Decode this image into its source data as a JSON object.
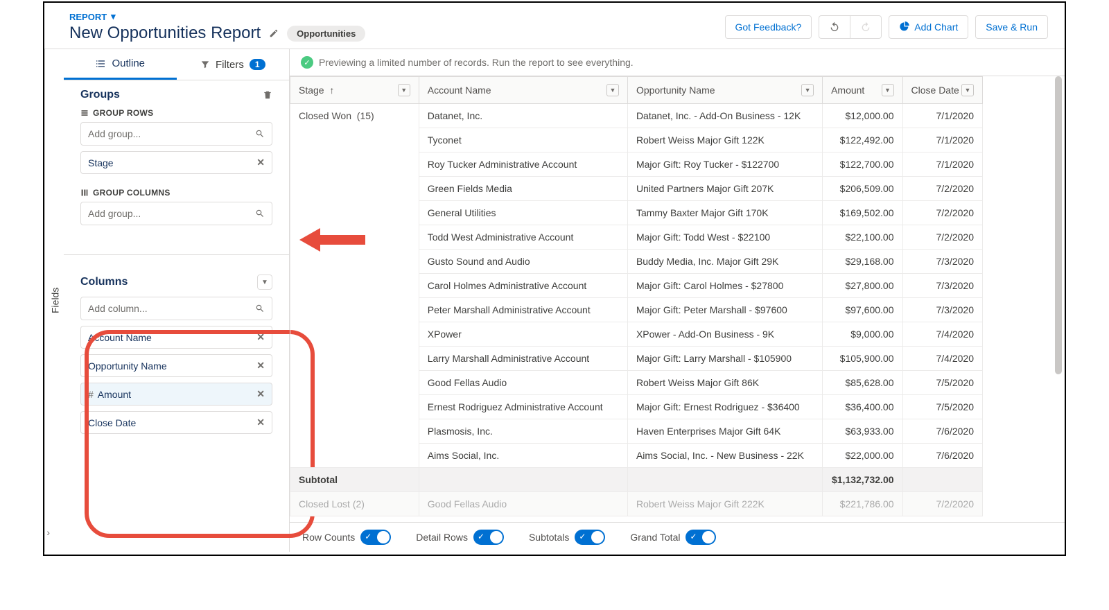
{
  "header": {
    "type_label": "REPORT",
    "title": "New Opportunities Report",
    "badge": "Opportunities",
    "feedback": "Got Feedback?",
    "add_chart": "Add Chart",
    "save_run": "Save & Run"
  },
  "fields_tab": "Fields",
  "sidebar": {
    "tabs": {
      "outline": "Outline",
      "filters": "Filters",
      "filter_count": "1"
    },
    "groups": {
      "title": "Groups",
      "rows_label": "GROUP ROWS",
      "rows_placeholder": "Add group...",
      "row_pill": "Stage",
      "cols_label": "GROUP COLUMNS",
      "cols_placeholder": "Add group..."
    },
    "columns": {
      "title": "Columns",
      "placeholder": "Add column...",
      "items": [
        "Account Name",
        "Opportunity Name",
        "# Amount",
        "Close Date"
      ]
    }
  },
  "preview_msg": "Previewing a limited number of records. Run the report to see everything.",
  "table": {
    "headers": [
      "Stage",
      "Account Name",
      "Opportunity Name",
      "Amount",
      "Close Date"
    ],
    "stage_group": "Closed Won",
    "stage_count": "(15)",
    "rows": [
      {
        "acct": "Datanet, Inc.",
        "opp": "Datanet, Inc. - Add-On Business - 12K",
        "amt": "$12,000.00",
        "date": "7/1/2020"
      },
      {
        "acct": "Tyconet",
        "opp": "Robert Weiss Major Gift 122K",
        "amt": "$122,492.00",
        "date": "7/1/2020"
      },
      {
        "acct": "Roy Tucker Administrative Account",
        "opp": "Major Gift: Roy Tucker - $122700",
        "amt": "$122,700.00",
        "date": "7/1/2020"
      },
      {
        "acct": "Green Fields Media",
        "opp": "United Partners Major Gift 207K",
        "amt": "$206,509.00",
        "date": "7/2/2020"
      },
      {
        "acct": "General Utilities",
        "opp": "Tammy Baxter Major Gift 170K",
        "amt": "$169,502.00",
        "date": "7/2/2020"
      },
      {
        "acct": "Todd West Administrative Account",
        "opp": "Major Gift: Todd West - $22100",
        "amt": "$22,100.00",
        "date": "7/2/2020"
      },
      {
        "acct": "Gusto Sound and Audio",
        "opp": "Buddy Media, Inc. Major Gift 29K",
        "amt": "$29,168.00",
        "date": "7/3/2020"
      },
      {
        "acct": "Carol Holmes Administrative Account",
        "opp": "Major Gift: Carol Holmes - $27800",
        "amt": "$27,800.00",
        "date": "7/3/2020"
      },
      {
        "acct": "Peter Marshall Administrative Account",
        "opp": "Major Gift: Peter Marshall - $97600",
        "amt": "$97,600.00",
        "date": "7/3/2020"
      },
      {
        "acct": "XPower",
        "opp": "XPower - Add-On Business - 9K",
        "amt": "$9,000.00",
        "date": "7/4/2020"
      },
      {
        "acct": "Larry Marshall Administrative Account",
        "opp": "Major Gift: Larry Marshall - $105900",
        "amt": "$105,900.00",
        "date": "7/4/2020"
      },
      {
        "acct": "Good Fellas Audio",
        "opp": "Robert Weiss Major Gift 86K",
        "amt": "$85,628.00",
        "date": "7/5/2020"
      },
      {
        "acct": "Ernest Rodriguez Administrative Account",
        "opp": "Major Gift: Ernest Rodriguez - $36400",
        "amt": "$36,400.00",
        "date": "7/5/2020"
      },
      {
        "acct": "Plasmosis, Inc.",
        "opp": "Haven Enterprises Major Gift 64K",
        "amt": "$63,933.00",
        "date": "7/6/2020"
      },
      {
        "acct": "Aims Social, Inc.",
        "opp": "Aims Social, Inc. - New Business - 22K",
        "amt": "$22,000.00",
        "date": "7/6/2020"
      }
    ],
    "subtotal_label": "Subtotal",
    "subtotal_amt": "$1,132,732.00",
    "next": {
      "stage": "Closed Lost (2)",
      "acct": "Good Fellas Audio",
      "opp": "Robert Weiss Major Gift 222K",
      "amt": "$221,786.00",
      "date": "7/2/2020"
    }
  },
  "footer": {
    "row_counts": "Row Counts",
    "detail_rows": "Detail Rows",
    "subtotals": "Subtotals",
    "grand_total": "Grand Total"
  }
}
